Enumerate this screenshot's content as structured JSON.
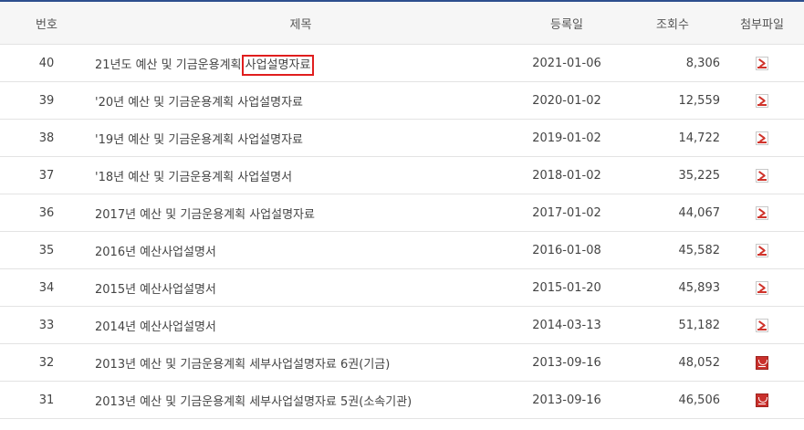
{
  "table": {
    "headers": {
      "no": "번호",
      "title": "제목",
      "date": "등록일",
      "views": "조회수",
      "file": "첨부파일"
    },
    "rows": [
      {
        "no": "40",
        "title_main": "21년도 예산 및 기금운용계획 ",
        "title_highlight": "사업설명자료",
        "date": "2021-01-06",
        "views": "8,306",
        "file_icon": "pdf-icon"
      },
      {
        "no": "39",
        "title_main": "'20년 예산 및 기금운용계획 사업설명자료",
        "title_highlight": "",
        "date": "2020-01-02",
        "views": "12,559",
        "file_icon": "pdf-icon"
      },
      {
        "no": "38",
        "title_main": "'19년 예산 및 기금운용계획 사업설명자료",
        "title_highlight": "",
        "date": "2019-01-02",
        "views": "14,722",
        "file_icon": "pdf-icon"
      },
      {
        "no": "37",
        "title_main": "'18년 예산 및 기금운용계획 사업설명서",
        "title_highlight": "",
        "date": "2018-01-02",
        "views": "35,225",
        "file_icon": "pdf-icon"
      },
      {
        "no": "36",
        "title_main": "2017년 예산 및 기금운용계획 사업설명자료",
        "title_highlight": "",
        "date": "2017-01-02",
        "views": "44,067",
        "file_icon": "pdf-icon"
      },
      {
        "no": "35",
        "title_main": "2016년 예산사업설명서",
        "title_highlight": "",
        "date": "2016-01-08",
        "views": "45,582",
        "file_icon": "pdf-icon"
      },
      {
        "no": "34",
        "title_main": "2015년 예산사업설명서",
        "title_highlight": "",
        "date": "2015-01-20",
        "views": "45,893",
        "file_icon": "pdf-icon"
      },
      {
        "no": "33",
        "title_main": "2014년 예산사업설명서",
        "title_highlight": "",
        "date": "2014-03-13",
        "views": "51,182",
        "file_icon": "pdf-icon"
      },
      {
        "no": "32",
        "title_main": "2013년 예산 및 기금운용계획 세부사업설명자료 6권(기금)",
        "title_highlight": "",
        "date": "2013-09-16",
        "views": "48,052",
        "file_icon": "hwp-icon"
      },
      {
        "no": "31",
        "title_main": "2013년 예산 및 기금운용계획 세부사업설명자료 5권(소속기관)",
        "title_highlight": "",
        "date": "2013-09-16",
        "views": "46,506",
        "file_icon": "hwp-icon"
      }
    ]
  },
  "colors": {
    "top_border": "#2d4f8e",
    "highlight_box": "#e01e1e"
  }
}
